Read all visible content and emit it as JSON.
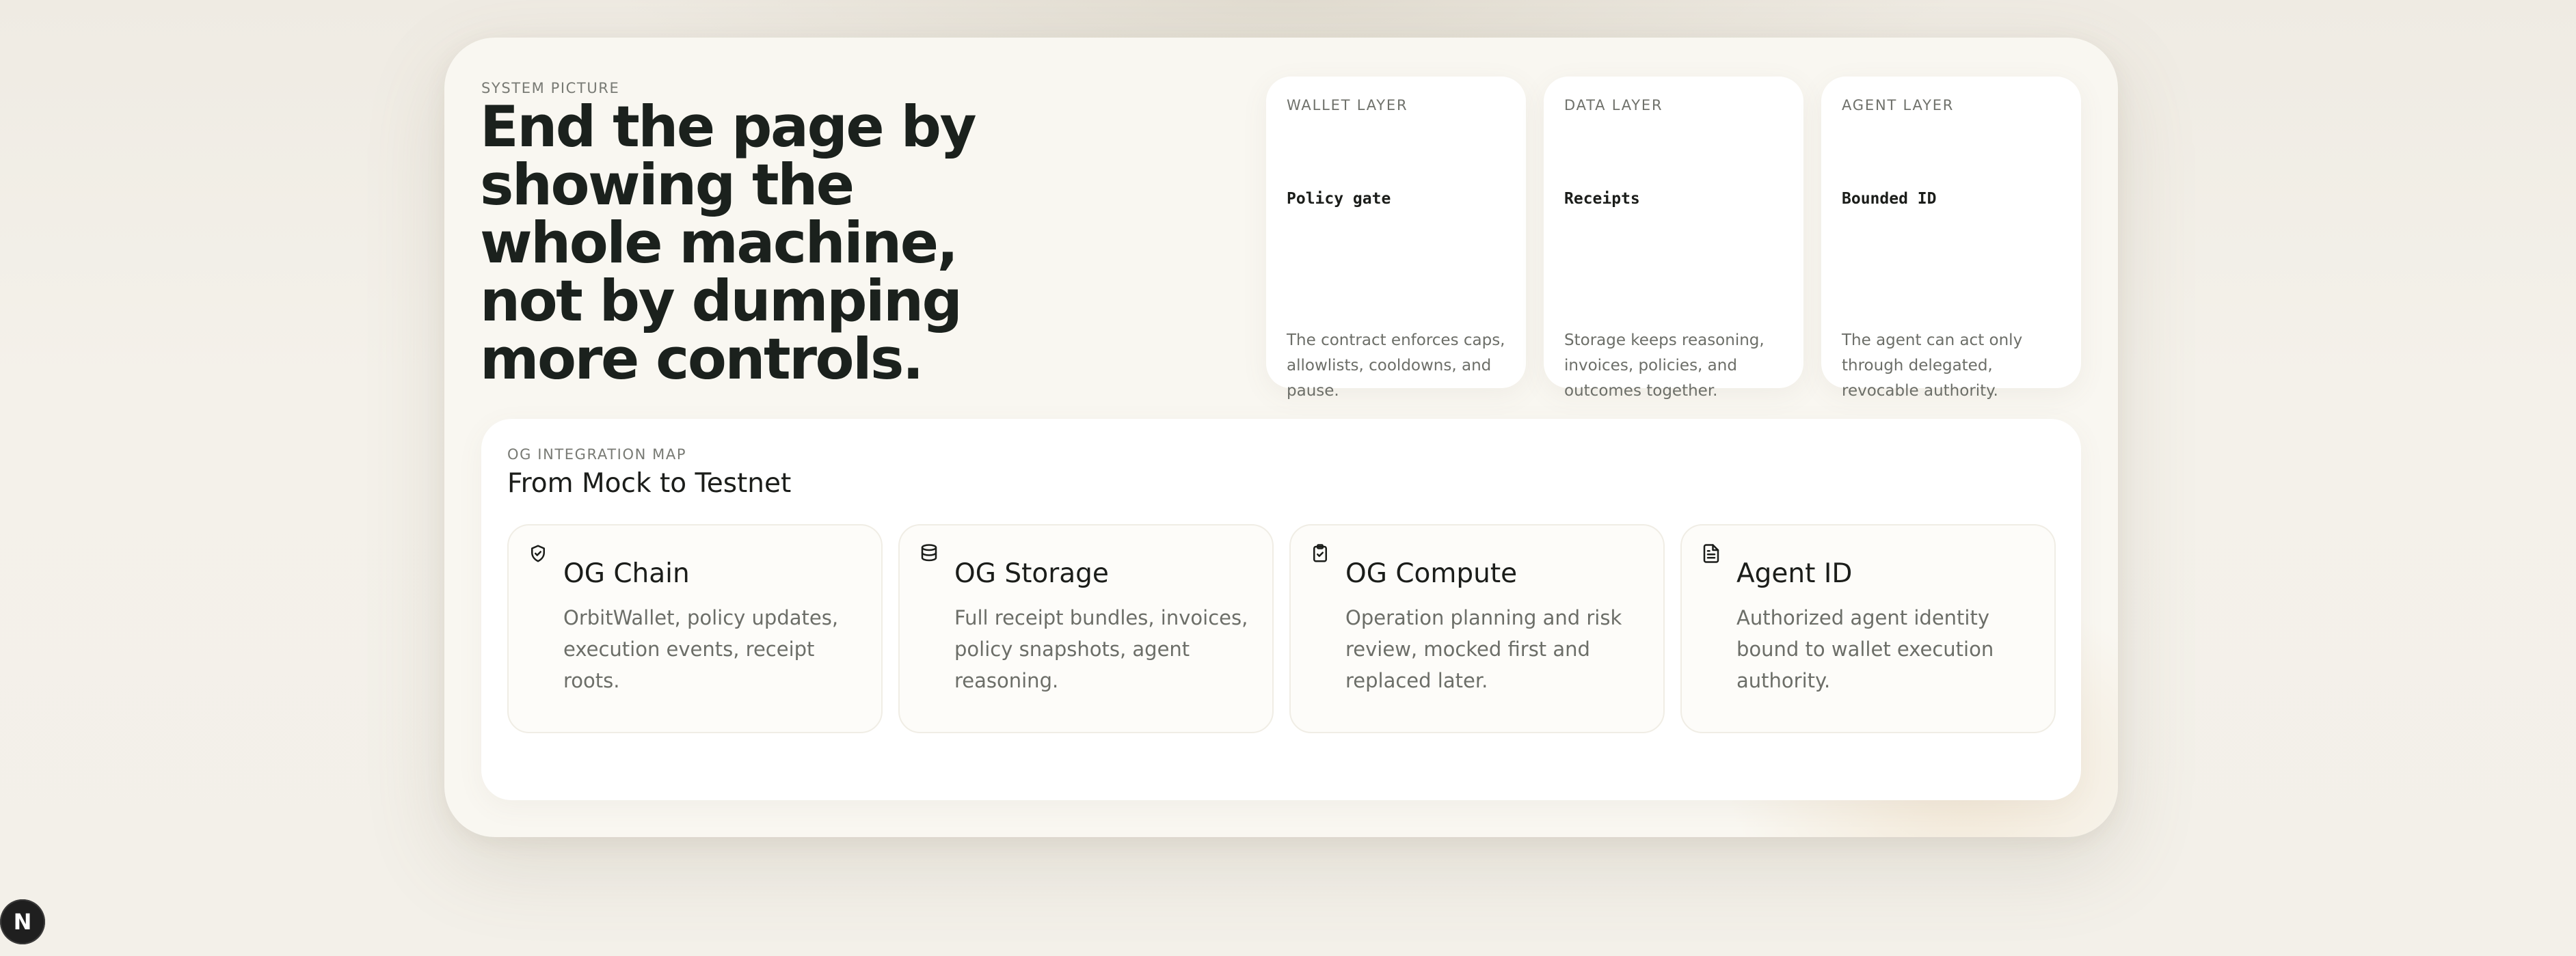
{
  "system": {
    "eyebrow": "SYSTEM PICTURE",
    "headline": "End the page by showing the whole machine, not by dumping more controls."
  },
  "layers": [
    {
      "label": "WALLET LAYER",
      "name": "Policy gate",
      "description": "The contract enforces caps, allowlists, cooldowns, and pause."
    },
    {
      "label": "DATA LAYER",
      "name": "Receipts",
      "description": "Storage keeps reasoning, invoices, policies, and outcomes together."
    },
    {
      "label": "AGENT LAYER",
      "name": "Bounded ID",
      "description": "The agent can act only through delegated, revocable authority."
    }
  ],
  "integration_map": {
    "eyebrow": "OG INTEGRATION MAP",
    "title": "From Mock to Testnet",
    "items": [
      {
        "icon": "shield-check-icon",
        "title": "OG Chain",
        "description": "OrbitWallet, policy updates, execution events, receipt roots."
      },
      {
        "icon": "database-icon",
        "title": "OG Storage",
        "description": "Full receipt bundles, invoices, policy snapshots, agent reasoning."
      },
      {
        "icon": "clipboard-check-icon",
        "title": "OG Compute",
        "description": "Operation planning and risk review, mocked first and replaced later."
      },
      {
        "icon": "file-text-icon",
        "title": "Agent ID",
        "description": "Authorized agent identity bound to wallet execution authority."
      }
    ]
  },
  "dev_badge": {
    "letter": "N",
    "icon": "nextjs-logo-icon"
  },
  "colors": {
    "page_bg": "#f3f0e9",
    "card_bg": "#ffffff",
    "text_primary": "#1b1d1a",
    "text_muted": "#6c6e68"
  }
}
